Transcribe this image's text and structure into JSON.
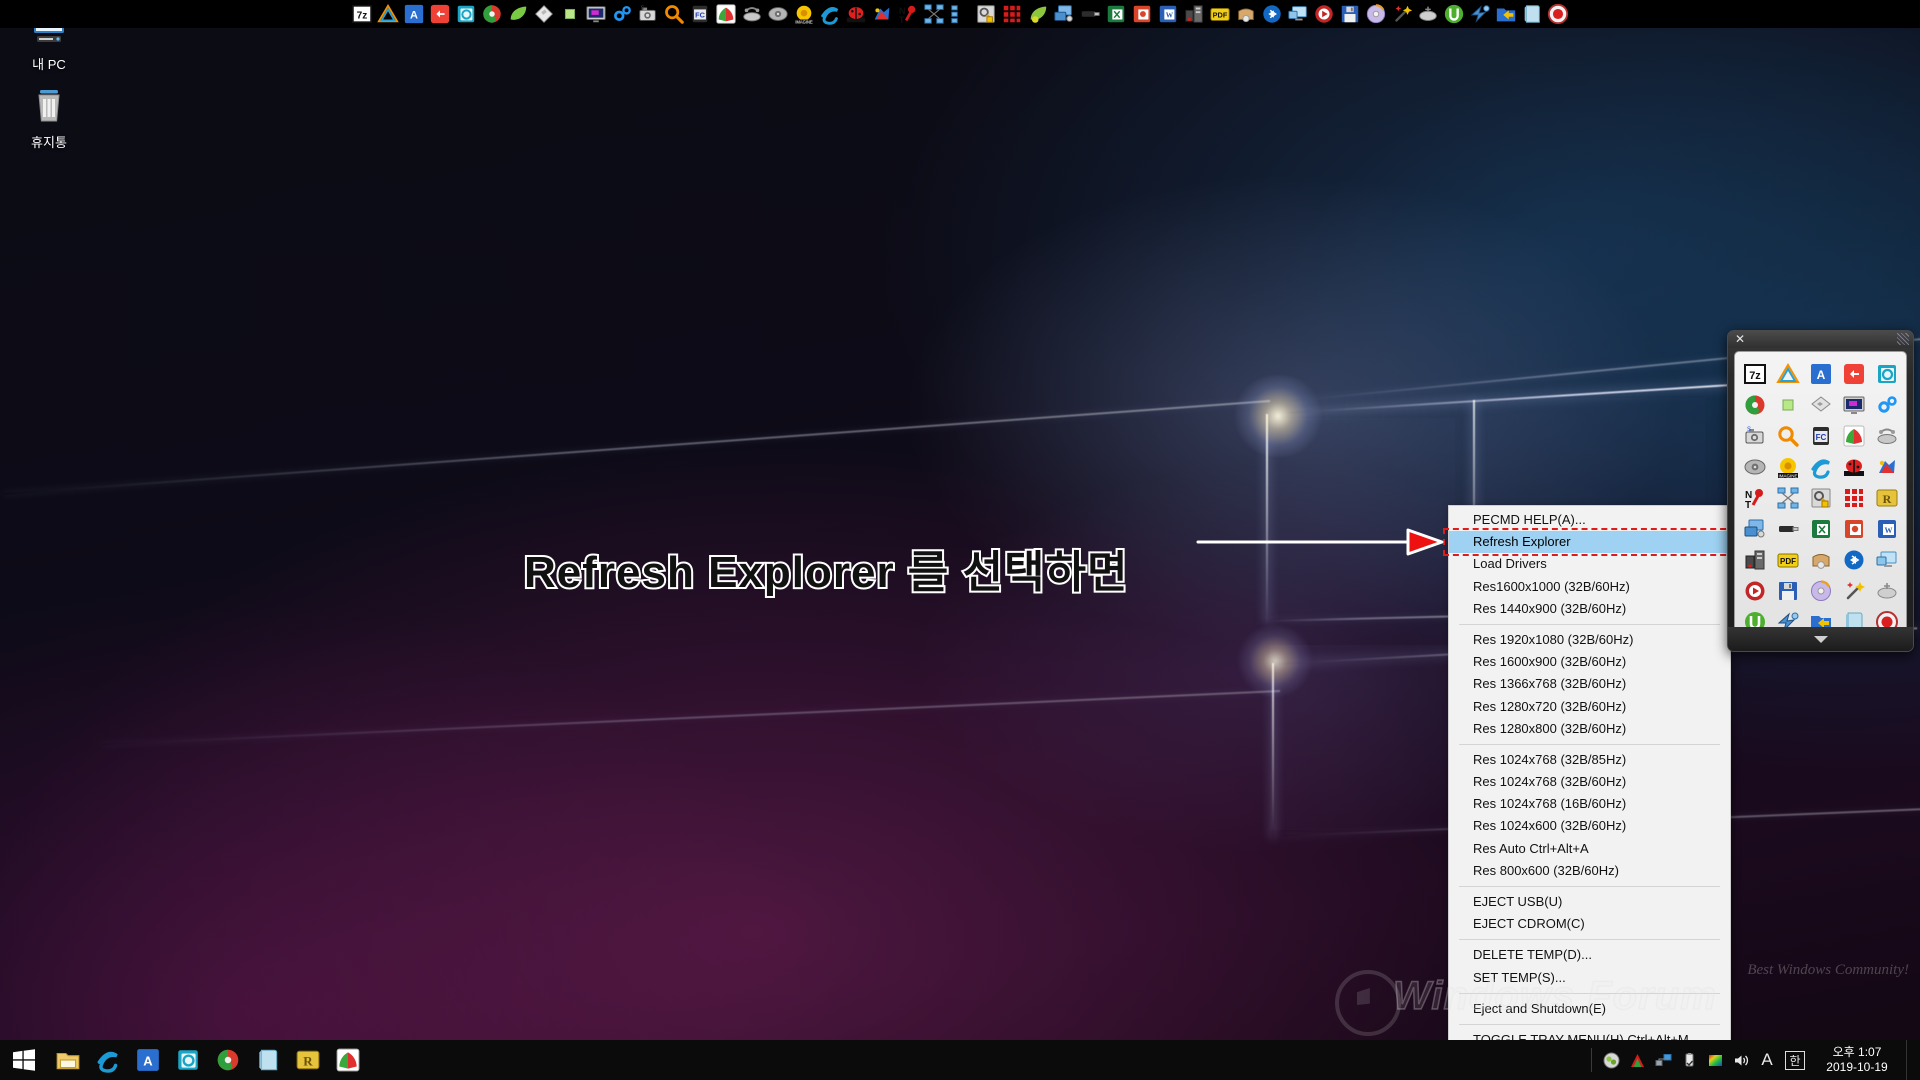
{
  "desktop": {
    "icons": [
      {
        "label": "내 PC",
        "icon": "monitor-icon"
      },
      {
        "label": "휴지통",
        "icon": "recycle-bin-icon"
      }
    ]
  },
  "annotation": {
    "callout_text": "Refresh Explorer 를 선택하면",
    "arrow_color": "#ee1111",
    "arrow_outline_color": "#ffffff",
    "highlight_box_color": "#e01b1b"
  },
  "context_menu": {
    "selected_item": "Refresh Explorer",
    "items": [
      {
        "label": "PECMD HELP(A)...",
        "selected": false,
        "separator_after": false
      },
      {
        "label": "Refresh Explorer",
        "selected": true,
        "separator_after": false
      },
      {
        "label": "Load Drivers",
        "selected": false,
        "separator_after": false
      },
      {
        "label": "Res1600x1000 (32B/60Hz)",
        "selected": false,
        "separator_after": false
      },
      {
        "label": "Res 1440x900 (32B/60Hz)",
        "selected": false,
        "separator_after": true
      },
      {
        "label": "Res 1920x1080 (32B/60Hz)",
        "selected": false,
        "separator_after": false
      },
      {
        "label": "Res 1600x900 (32B/60Hz)",
        "selected": false,
        "separator_after": false
      },
      {
        "label": "Res 1366x768 (32B/60Hz)",
        "selected": false,
        "separator_after": false
      },
      {
        "label": "Res 1280x720 (32B/60Hz)",
        "selected": false,
        "separator_after": false
      },
      {
        "label": "Res 1280x800 (32B/60Hz)",
        "selected": false,
        "separator_after": true
      },
      {
        "label": "Res 1024x768 (32B/85Hz)",
        "selected": false,
        "separator_after": false
      },
      {
        "label": "Res 1024x768 (32B/60Hz)",
        "selected": false,
        "separator_after": false
      },
      {
        "label": "Res 1024x768 (16B/60Hz)",
        "selected": false,
        "separator_after": false
      },
      {
        "label": "Res 1024x600 (32B/60Hz)",
        "selected": false,
        "separator_after": false
      },
      {
        "label": "Res Auto Ctrl+Alt+A",
        "selected": false,
        "separator_after": false
      },
      {
        "label": "Res 800x600 (32B/60Hz)",
        "selected": false,
        "separator_after": true
      },
      {
        "label": "EJECT USB(U)",
        "selected": false,
        "separator_after": false
      },
      {
        "label": "EJECT CDROM(C)",
        "selected": false,
        "separator_after": true
      },
      {
        "label": "DELETE TEMP(D)...",
        "selected": false,
        "separator_after": false
      },
      {
        "label": "SET TEMP(S)...",
        "selected": false,
        "separator_after": true
      },
      {
        "label": "Eject and Shutdown(E)",
        "selected": false,
        "separator_after": true
      },
      {
        "label": "TOGGLE TRAY MENU(H) Ctrl+Alt+M",
        "selected": false,
        "separator_after": false
      }
    ]
  },
  "tray_panel": {
    "close_label": "✕",
    "icons": [
      "7zip-icon",
      "acronis-trueimage-icon",
      "acronis-disk-director-icon",
      "aomei-backupper-icon",
      "aomei-partition-icon",
      "paint-icon",
      "green-square-icon",
      "diskgenius-icon",
      "vnc-monitor-icon",
      "gears-settings-icon",
      "screenshot-camera-icon",
      "magnifier-search-icon",
      "filecommander-icon",
      "crystaldiskinfo-icon",
      "network-drive-icon",
      "hdd-icon",
      "imagine-viewer-icon",
      "internet-explorer-icon",
      "ladybug-tool-icon",
      "paint-tools-icon",
      "nt-password-icon",
      "network-map-icon",
      "registry-tool-icon",
      "grid-red-icon",
      "r-drive-image-icon",
      "remote-desktop-icon",
      "usb-flash-icon",
      "excel-viewer-icon",
      "powerpoint-viewer-icon",
      "word-viewer-icon",
      "server-tools-icon",
      "pdf-viewer-icon",
      "archive-box-icon",
      "teamviewer-icon",
      "display-monitor-icon",
      "media-player-icon",
      "floppy-save-icon",
      "cd-burner-icon",
      "magic-wand-icon",
      "usb-eject-icon",
      "utorrent-icon",
      "bolt-driver-icon",
      "folder-arrow-icon",
      "notepad-icon",
      "record-button-icon"
    ]
  },
  "topbar": {
    "icons": [
      "7zip-icon",
      "acronis-trueimage-icon",
      "acronis-disk-director-icon",
      "aomei-backupper-icon",
      "aomei-partition-icon",
      "paint-icon",
      "leaf-icon",
      "diamond-disk-icon",
      "green-square-icon",
      "vnc-monitor-icon",
      "gears-settings-icon",
      "screenshot-camera-icon",
      "magnifier-search-icon",
      "filecommander-icon",
      "crystaldiskinfo-icon",
      "network-drive-icon",
      "hdd-icon",
      "imagine-viewer-icon",
      "internet-explorer-icon",
      "ladybug-tool-icon",
      "paint-tools-icon",
      "nt-password-icon",
      "network-map-icon",
      "network-map2-icon",
      "registry-tool-icon",
      "grid-red-icon",
      "leaf2-icon",
      "remote-desktop-icon",
      "usb-flash-icon",
      "excel-viewer-icon",
      "powerpoint-viewer-icon",
      "word-viewer-icon",
      "server-tools-icon",
      "pdf-viewer-icon",
      "archive-box-icon",
      "teamviewer-icon",
      "display-monitor-icon",
      "media-player-icon",
      "floppy-save-icon",
      "cd-burner-icon",
      "magic-wand-icon",
      "usb-eject-icon",
      "utorrent-icon",
      "bolt-driver-icon",
      "folder-arrow-icon",
      "notepad-icon",
      "record-button-icon"
    ]
  },
  "taskbar": {
    "start_label": "start-button",
    "pinned": [
      "file-explorer-icon",
      "internet-explorer-icon",
      "acronis-disk-director-icon",
      "aomei-partition-icon",
      "paint-icon",
      "notepad-icon",
      "r-drive-image-icon",
      "crystaldiskinfo-icon"
    ],
    "tray_icons": [
      "safely-remove-icon",
      "antivirus-icon",
      "network-icon",
      "usb-device-icon",
      "color-profile-icon",
      "volume-icon"
    ],
    "ime_letter": "A",
    "ime_korean": "한",
    "clock_time": "오후 1:07",
    "clock_date": "2019-10-19"
  },
  "watermark": {
    "tagline": "Best Windows Community!",
    "title": "Windows Forum"
  }
}
